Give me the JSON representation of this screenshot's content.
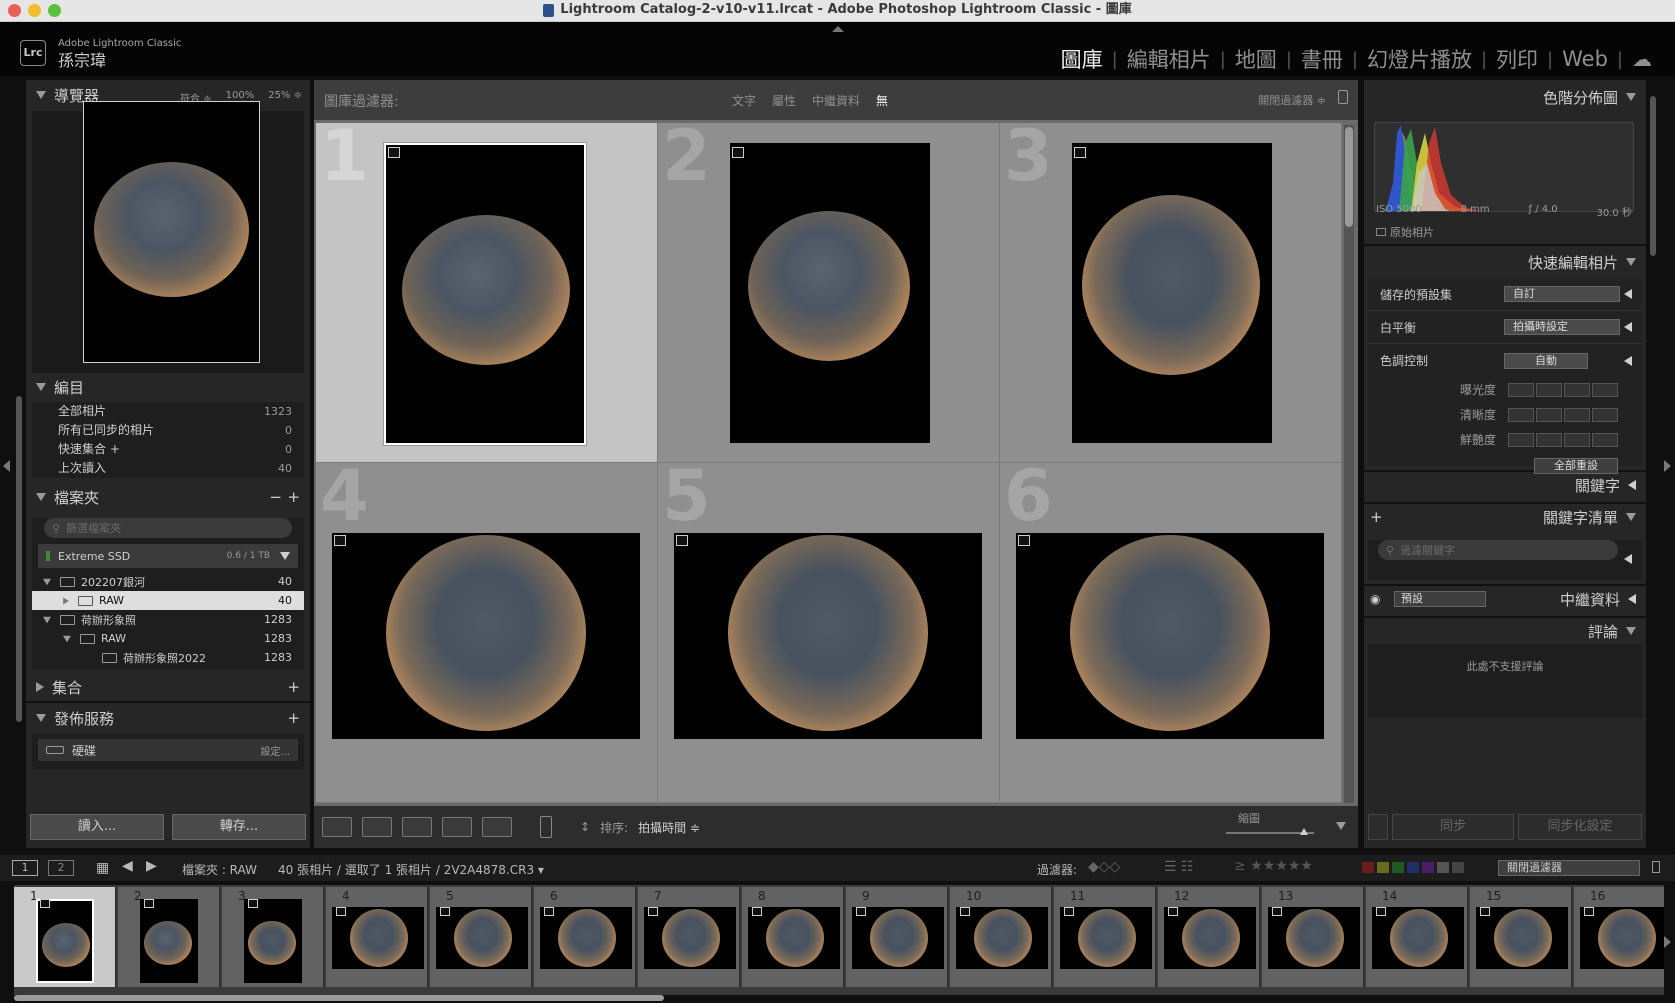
{
  "window": {
    "title": "Lightroom Catalog-2-v10-v11.lrcat - Adobe Photoshop Lightroom Classic - 圖庫"
  },
  "identity": {
    "logo": "Lrc",
    "product": "Adobe Lightroom Classic",
    "user": "孫宗瑋"
  },
  "modules": [
    "圖庫",
    "編輯相片",
    "地圖",
    "書冊",
    "幻燈片播放",
    "列印",
    "Web"
  ],
  "navigator": {
    "title": "導覽器",
    "opts": [
      "符合 ≑",
      "100%",
      "25% ≑"
    ]
  },
  "catalog": {
    "title": "編目",
    "rows": [
      {
        "label": "全部相片",
        "count": "1323"
      },
      {
        "label": "所有已同步的相片",
        "count": "0"
      },
      {
        "label": "快速集合 +",
        "count": "0"
      },
      {
        "label": "上次讀入",
        "count": "40"
      }
    ]
  },
  "folders": {
    "title": "檔案夾",
    "search_placeholder": "篩選檔案夾",
    "volume": {
      "name": "Extreme SSD",
      "size": "0.6 / 1 TB"
    },
    "items": [
      {
        "label": "202207銀河",
        "count": "40",
        "level": 0
      },
      {
        "label": "RAW",
        "count": "40",
        "level": 1
      },
      {
        "label": "荷辦形象照",
        "count": "1283",
        "level": 0
      },
      {
        "label": "RAW",
        "count": "1283",
        "level": 1
      },
      {
        "label": "荷辦形象照2022",
        "count": "1283",
        "level": 2
      }
    ]
  },
  "collections": {
    "title": "集合"
  },
  "publish": {
    "title": "發佈服務",
    "service": "硬碟",
    "setup": "設定..."
  },
  "left_buttons": {
    "import": "讀入...",
    "export": "轉存..."
  },
  "filter": {
    "label": "圖庫過濾器:",
    "tabs": [
      "文字",
      "屬性",
      "中繼資料",
      "無"
    ],
    "preset": "關閉過濾器 ≑"
  },
  "grid": {
    "cells": [
      "1",
      "2",
      "3",
      "4",
      "5",
      "6"
    ]
  },
  "toolbar": {
    "sort_label": "排序:",
    "sort_value": "拍攝時間 ≑",
    "thumb_label": "縮圖"
  },
  "histogram": {
    "title": "色階分佈圖",
    "info": [
      "ISO 5000",
      "8 mm",
      "ƒ / 4.0",
      "30.0 秒"
    ],
    "original": "原始相片"
  },
  "quick_develop": {
    "title": "快速編輯相片",
    "rows": [
      {
        "label": "儲存的預設集",
        "value": "自訂"
      },
      {
        "label": "白平衡",
        "value": "拍攝時設定"
      },
      {
        "label": "色調控制",
        "value": "自動"
      }
    ],
    "adjust": [
      "曝光度",
      "清晰度",
      "鮮艷度"
    ],
    "reset": "全部重設"
  },
  "keywording": {
    "title": "關鍵字"
  },
  "keyword_list": {
    "title": "關鍵字清單",
    "search_placeholder": "過濾關鍵字"
  },
  "metadata": {
    "title": "中繼資料",
    "preset": "預設"
  },
  "comments": {
    "title": "評論",
    "message": "此處不支援評論"
  },
  "right_buttons": {
    "sync": "同步",
    "sync_settings": "同步化設定"
  },
  "filmstrip": {
    "source": "檔案夾 : RAW",
    "count_text": "40 張相片 / 選取了 1 張相片 / 2V2A4878.CR3 ▾",
    "filter_label": "過濾器:",
    "filter_value": "關閉過濾器",
    "nums": [
      "1",
      "2",
      "3",
      "4",
      "5",
      "6",
      "7",
      "8",
      "9",
      "10",
      "11",
      "12",
      "13",
      "14",
      "15",
      "16"
    ]
  }
}
